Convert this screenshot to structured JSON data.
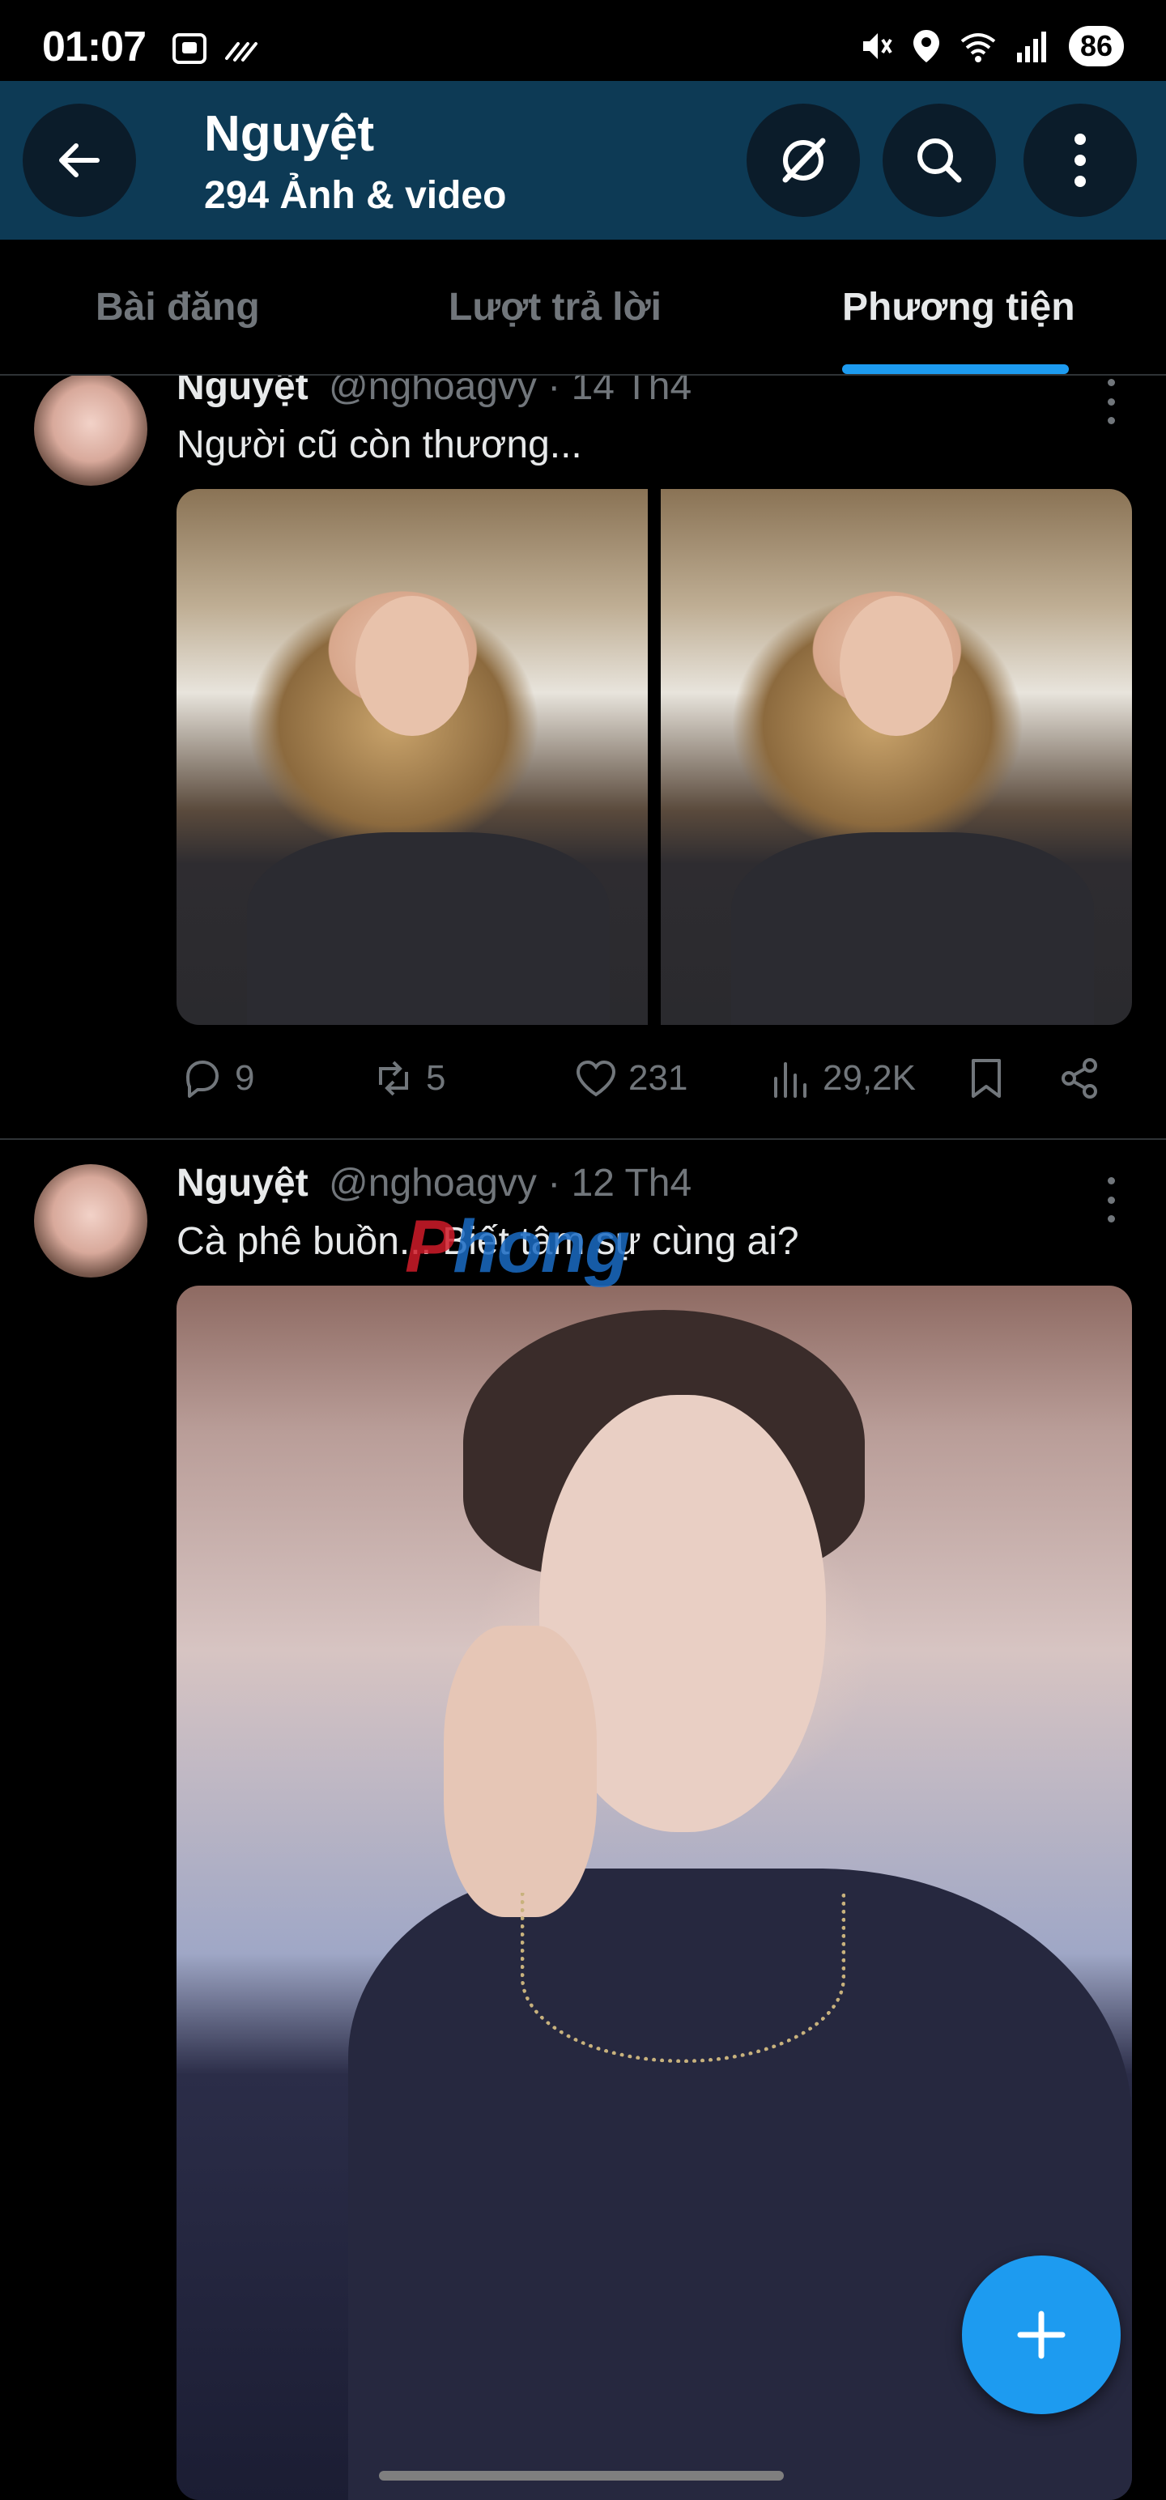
{
  "status_bar": {
    "time": "01:07",
    "battery": "86"
  },
  "header": {
    "title": "Nguyệt",
    "subtitle": "294 Ảnh & video"
  },
  "tabs": [
    {
      "label": "Bài đăng",
      "active": false
    },
    {
      "label": "Lượt trả lời",
      "active": false
    },
    {
      "label": "Phương tiện",
      "active": true
    }
  ],
  "posts": [
    {
      "name": "Nguyệt",
      "meta": "@nghoagvy · 14 Th4",
      "text": "Người cũ còn thương...",
      "actions": {
        "replies": "9",
        "reposts": "5",
        "likes": "231",
        "views": "29,2K"
      }
    },
    {
      "name": "Nguyệt",
      "meta": "@nghoagvy · 12 Th4",
      "text": "Cà phê buồn... Biết tâm sự cùng ai?"
    }
  ],
  "watermark": {
    "part_a": "P",
    "part_b": "hong"
  },
  "colors": {
    "accent": "#1d9bf0",
    "header_bg": "#0d3a55",
    "muted": "#71767b"
  }
}
